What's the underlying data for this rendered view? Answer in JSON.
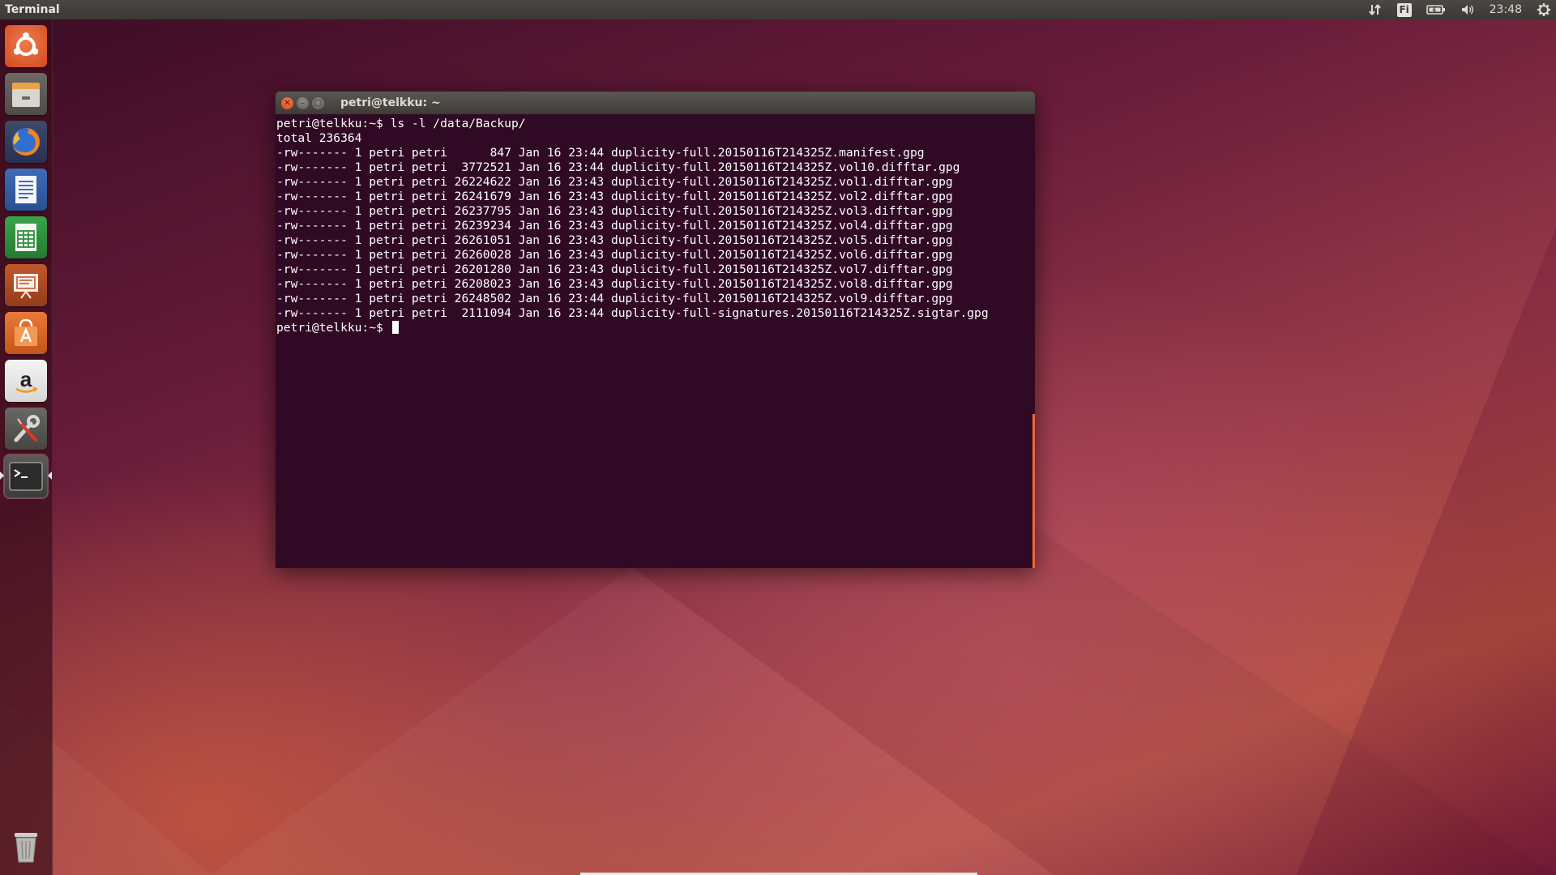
{
  "top_panel": {
    "app_name": "Terminal",
    "keyboard_layout": "Fi",
    "clock": "23:48",
    "indicators": [
      "network-icon",
      "keyboard-layout-icon",
      "battery-icon",
      "volume-icon",
      "clock",
      "gear-icon"
    ]
  },
  "launcher": {
    "items": [
      {
        "name": "dash-home",
        "icon": "ubuntu-logo-icon"
      },
      {
        "name": "files",
        "icon": "file-cabinet-icon"
      },
      {
        "name": "firefox",
        "icon": "firefox-icon"
      },
      {
        "name": "libreoffice-writer",
        "icon": "writer-document-icon"
      },
      {
        "name": "libreoffice-calc",
        "icon": "calc-spreadsheet-icon"
      },
      {
        "name": "libreoffice-impress",
        "icon": "impress-presentation-icon"
      },
      {
        "name": "ubuntu-software-center",
        "icon": "shopping-bag-icon"
      },
      {
        "name": "amazon",
        "icon": "amazon-icon"
      },
      {
        "name": "system-settings",
        "icon": "wrench-screwdriver-icon"
      },
      {
        "name": "terminal",
        "icon": "terminal-icon",
        "running": true
      },
      {
        "name": "trash",
        "icon": "trash-icon"
      }
    ]
  },
  "window": {
    "title": "petri@telkku: ~"
  },
  "terminal": {
    "lines": [
      "petri@telkku:~$ ls -l /data/Backup/",
      "total 236364",
      "-rw------- 1 petri petri      847 Jan 16 23:44 duplicity-full.20150116T214325Z.manifest.gpg",
      "-rw------- 1 petri petri  3772521 Jan 16 23:44 duplicity-full.20150116T214325Z.vol10.difftar.gpg",
      "-rw------- 1 petri petri 26224622 Jan 16 23:43 duplicity-full.20150116T214325Z.vol1.difftar.gpg",
      "-rw------- 1 petri petri 26241679 Jan 16 23:43 duplicity-full.20150116T214325Z.vol2.difftar.gpg",
      "-rw------- 1 petri petri 26237795 Jan 16 23:43 duplicity-full.20150116T214325Z.vol3.difftar.gpg",
      "-rw------- 1 petri petri 26239234 Jan 16 23:43 duplicity-full.20150116T214325Z.vol4.difftar.gpg",
      "-rw------- 1 petri petri 26261051 Jan 16 23:43 duplicity-full.20150116T214325Z.vol5.difftar.gpg",
      "-rw------- 1 petri petri 26260028 Jan 16 23:43 duplicity-full.20150116T214325Z.vol6.difftar.gpg",
      "-rw------- 1 petri petri 26201280 Jan 16 23:43 duplicity-full.20150116T214325Z.vol7.difftar.gpg",
      "-rw------- 1 petri petri 26208023 Jan 16 23:43 duplicity-full.20150116T214325Z.vol8.difftar.gpg",
      "-rw------- 1 petri petri 26248502 Jan 16 23:44 duplicity-full.20150116T214325Z.vol9.difftar.gpg",
      "-rw------- 1 petri petri  2111094 Jan 16 23:44 duplicity-full-signatures.20150116T214325Z.sigtar.gpg"
    ],
    "prompt": "petri@telkku:~$ "
  },
  "colors": {
    "terminal_bg": "#300a24",
    "terminal_fg": "#ffffff",
    "close_button": "#e6572a",
    "scrollbar": "#e8683a",
    "panel_bg": "#3c3b37"
  }
}
